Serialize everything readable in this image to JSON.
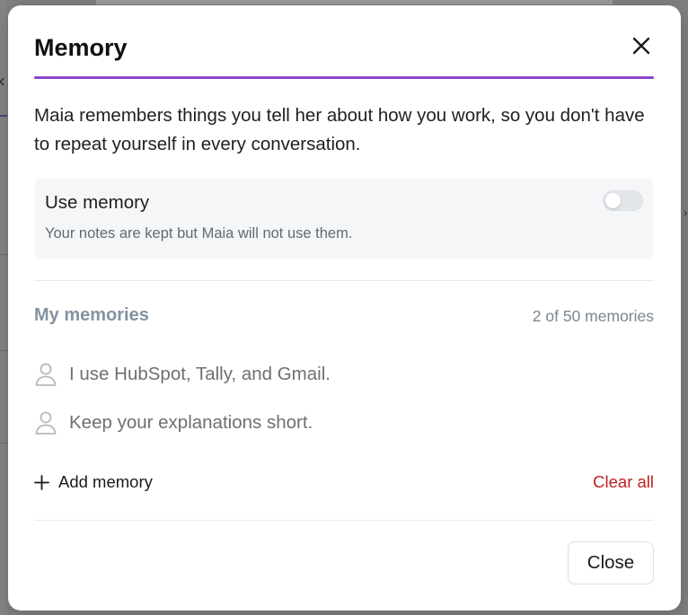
{
  "dialog": {
    "title": "Memory",
    "accent_color": "#8e44c7",
    "description": "Maia remembers things you tell her about how you work, so you don't have to repeat yourself in every conversation."
  },
  "use_memory": {
    "label": "Use memory",
    "sublabel": "Your notes are kept but Maia will not use them.",
    "enabled": false
  },
  "memories": {
    "section_title": "My memories",
    "count_label": "2 of 50 memories",
    "items": [
      {
        "text": "I use HubSpot, Tally, and Gmail.",
        "icon": "user-icon"
      },
      {
        "text": "Keep your explanations short.",
        "icon": "user-icon"
      }
    ],
    "add_label": "Add memory",
    "clear_label": "Clear all",
    "clear_color": "#c21f1f"
  },
  "footer": {
    "close_label": "Close"
  }
}
